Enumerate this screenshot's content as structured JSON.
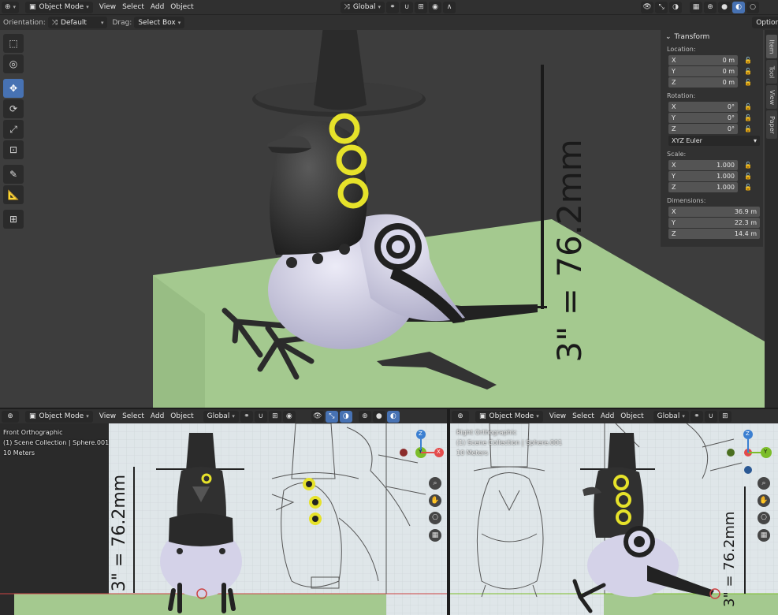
{
  "top_header": {
    "mode": "Object Mode",
    "menus": [
      "View",
      "Select",
      "Add",
      "Object"
    ],
    "transform_orientation": "Global"
  },
  "tool_header": {
    "orientation_label": "Orientation:",
    "orientation_value": "Default",
    "drag_label": "Drag:",
    "drag_value": "Select Box",
    "options_label": "Options"
  },
  "main_viewport": {
    "annotation_text": "3\" = 76.2mm"
  },
  "n_panel": {
    "section_title": "Transform",
    "location": {
      "label": "Location:",
      "rows": [
        {
          "axis": "X",
          "value": "0 m"
        },
        {
          "axis": "Y",
          "value": "0 m"
        },
        {
          "axis": "Z",
          "value": "0 m"
        }
      ]
    },
    "rotation": {
      "label": "Rotation:",
      "rows": [
        {
          "axis": "X",
          "value": "0°"
        },
        {
          "axis": "Y",
          "value": "0°"
        },
        {
          "axis": "Z",
          "value": "0°"
        }
      ],
      "mode": "XYZ Euler"
    },
    "scale": {
      "label": "Scale:",
      "rows": [
        {
          "axis": "X",
          "value": "1.000"
        },
        {
          "axis": "Y",
          "value": "1.000"
        },
        {
          "axis": "Z",
          "value": "1.000"
        }
      ]
    },
    "dimensions": {
      "label": "Dimensions:",
      "rows": [
        {
          "axis": "X",
          "value": "36.9 m"
        },
        {
          "axis": "Y",
          "value": "22.3 m"
        },
        {
          "axis": "Z",
          "value": "14.4 m"
        }
      ]
    },
    "tabs": [
      "Item",
      "Tool",
      "View",
      "Paper"
    ]
  },
  "front_viewport": {
    "mode": "Object Mode",
    "menus": [
      "View",
      "Select",
      "Add",
      "Object"
    ],
    "orientation": "Global",
    "overlay_line1": "Front Orthographic",
    "overlay_line2": "(1) Scene Collection | Sphere.001",
    "overlay_line3": "10 Meters",
    "annotation_text": "3\" = 76.2mm",
    "gizmo_axes": [
      "Z",
      "Y",
      "X"
    ]
  },
  "right_viewport": {
    "mode": "Object Mode",
    "menus": [
      "View",
      "Select",
      "Add",
      "Object"
    ],
    "orientation": "Global",
    "overlay_line1": "Right Orthographic",
    "overlay_line2": "(1) Scene Collection | Sphere.001",
    "overlay_line3": "10 Meters",
    "annotation_text": "3\" = 76.2mm",
    "gizmo_axes": [
      "Z",
      "Y"
    ]
  },
  "colors": {
    "accent_blue": "#4772b3",
    "ground_green": "#a4c98f",
    "body_dark": "#2e2e2e",
    "body_light": "#d4d2e8",
    "eye_yellow": "#e6e22a",
    "axis_x": "#e44b4b",
    "axis_y": "#7cbd2a",
    "axis_z": "#3b7fd1"
  }
}
